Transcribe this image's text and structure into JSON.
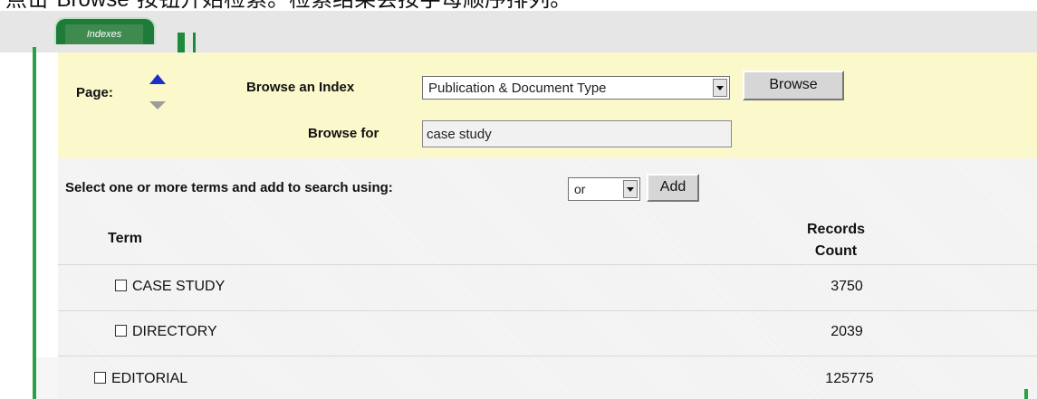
{
  "caption": "点击\"Browse\"按钮开始检索。检索结果会按字母顺序排列。",
  "tabs": [
    {
      "label": "Indexes"
    }
  ],
  "browse": {
    "page_label": "Page:",
    "index_label": "Browse an Index",
    "index_value": "Publication & Document Type",
    "button_label": "Browse",
    "for_label": "Browse for",
    "for_value": "case study"
  },
  "add_terms": {
    "label": "Select one or more terms and add to search using:",
    "operator_value": "or",
    "add_label": "Add"
  },
  "table": {
    "col_term": "Term",
    "col_records_line1": "Records",
    "col_records_line2": "Count",
    "rows": [
      {
        "term": "CASE STUDY",
        "count": "3750"
      },
      {
        "term": "DIRECTORY",
        "count": "2039"
      },
      {
        "term": "EDITORIAL",
        "count": "125775"
      }
    ]
  },
  "icons": {
    "page_up": "arrow-up-icon",
    "page_down": "arrow-down-icon",
    "dropdown": "chevron-down-icon"
  },
  "colors": {
    "accent_green": "#29a146",
    "panel_yellow": "#fbf8cc",
    "arrow_blue": "#1d2fc9"
  }
}
